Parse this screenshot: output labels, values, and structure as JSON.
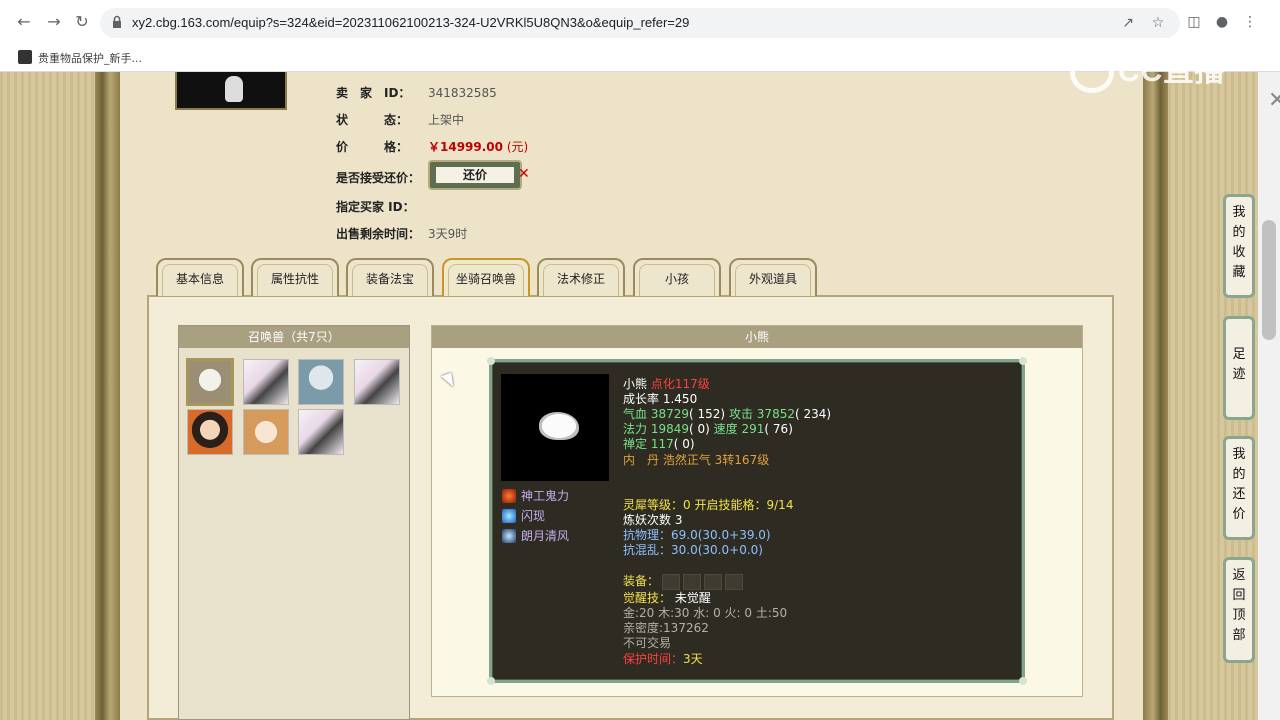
{
  "browser": {
    "url": "xy2.cbg.163.com/equip?s=324&eid=202311062100213-324-U2VRKl5U8QN3&o&equip_refer=29",
    "bookmark_label": "贵重物品保护_新手...",
    "nav_icons": [
      "back-icon",
      "forward-icon",
      "reload-icon"
    ],
    "overlay_logo": "CC直播"
  },
  "seller": {
    "rows": [
      {
        "label": "卖　家　ID：",
        "value": "341832585"
      },
      {
        "label": "状　　　态：",
        "value": "上架中"
      },
      {
        "label": "价　　　格：",
        "value": "￥14999.00",
        "unit": "(元)"
      },
      {
        "label": "是否接受还价：",
        "value": ""
      },
      {
        "label": "指定买家 ID：",
        "value": ""
      },
      {
        "label": "出售剩余时间：",
        "value": "3天9时"
      }
    ],
    "counter_button": "还价",
    "counter_close": "✕"
  },
  "tabs": [
    {
      "label": "基本信息",
      "active": false
    },
    {
      "label": "属性抗性",
      "active": false
    },
    {
      "label": "装备法宝",
      "active": false
    },
    {
      "label": "坐骑召唤兽",
      "active": true
    },
    {
      "label": "法术修正",
      "active": false
    },
    {
      "label": "小孩",
      "active": false
    },
    {
      "label": "外观道具",
      "active": false
    }
  ],
  "pet_list": {
    "header": "召唤兽（共7只）",
    "count": 7,
    "selected_index": 0
  },
  "pet_detail": {
    "header": "小熊",
    "name": "小熊",
    "level_note": "点化117级",
    "growth_label": "成长率",
    "growth": "1.450",
    "hp_label": "气血",
    "hp": "38729",
    "hp_points": "( 152)",
    "atk_label": "攻击",
    "atk": "37852",
    "atk_points": "( 234)",
    "mp_label": "法力",
    "mp": "19849",
    "mp_points": "( 0)",
    "spd_label": "速度",
    "spd": "291",
    "spd_points": "( 76)",
    "zen_label": "禅定",
    "zen": "117",
    "zen_points": "( 0)",
    "inner_label": "内　丹",
    "inner_value": "浩然正气 3转167级",
    "skills": [
      "神工鬼力",
      "闪现",
      "朗月清风"
    ],
    "spirit_label": "灵犀等级：",
    "spirit_value": "0",
    "spirit_slot_label": "开启技能格：",
    "spirit_slot_value": "9/14",
    "refine_label": "炼妖次数",
    "refine_value": "3",
    "resist_phys_label": "抗物理：",
    "resist_phys_value": "69.0",
    "resist_phys_detail": "(30.0+39.0)",
    "resist_chaos_label": "抗混乱：",
    "resist_chaos_value": "30.0",
    "resist_chaos_detail": "(30.0+0.0)",
    "equip_label": "装备：",
    "awaken_label": "觉醒技：",
    "awaken_value": "未觉醒",
    "elements": "金:20 木:30 水: 0 火: 0 土:50",
    "intimacy": "亲密度:137262",
    "trade": "不可交易",
    "protect_label": "保护时间：",
    "protect_value": "3天"
  },
  "side_menu": [
    {
      "label": "我的收藏"
    },
    {
      "label": "足迹"
    },
    {
      "label": "我的还价"
    },
    {
      "label": "返回顶部"
    }
  ]
}
